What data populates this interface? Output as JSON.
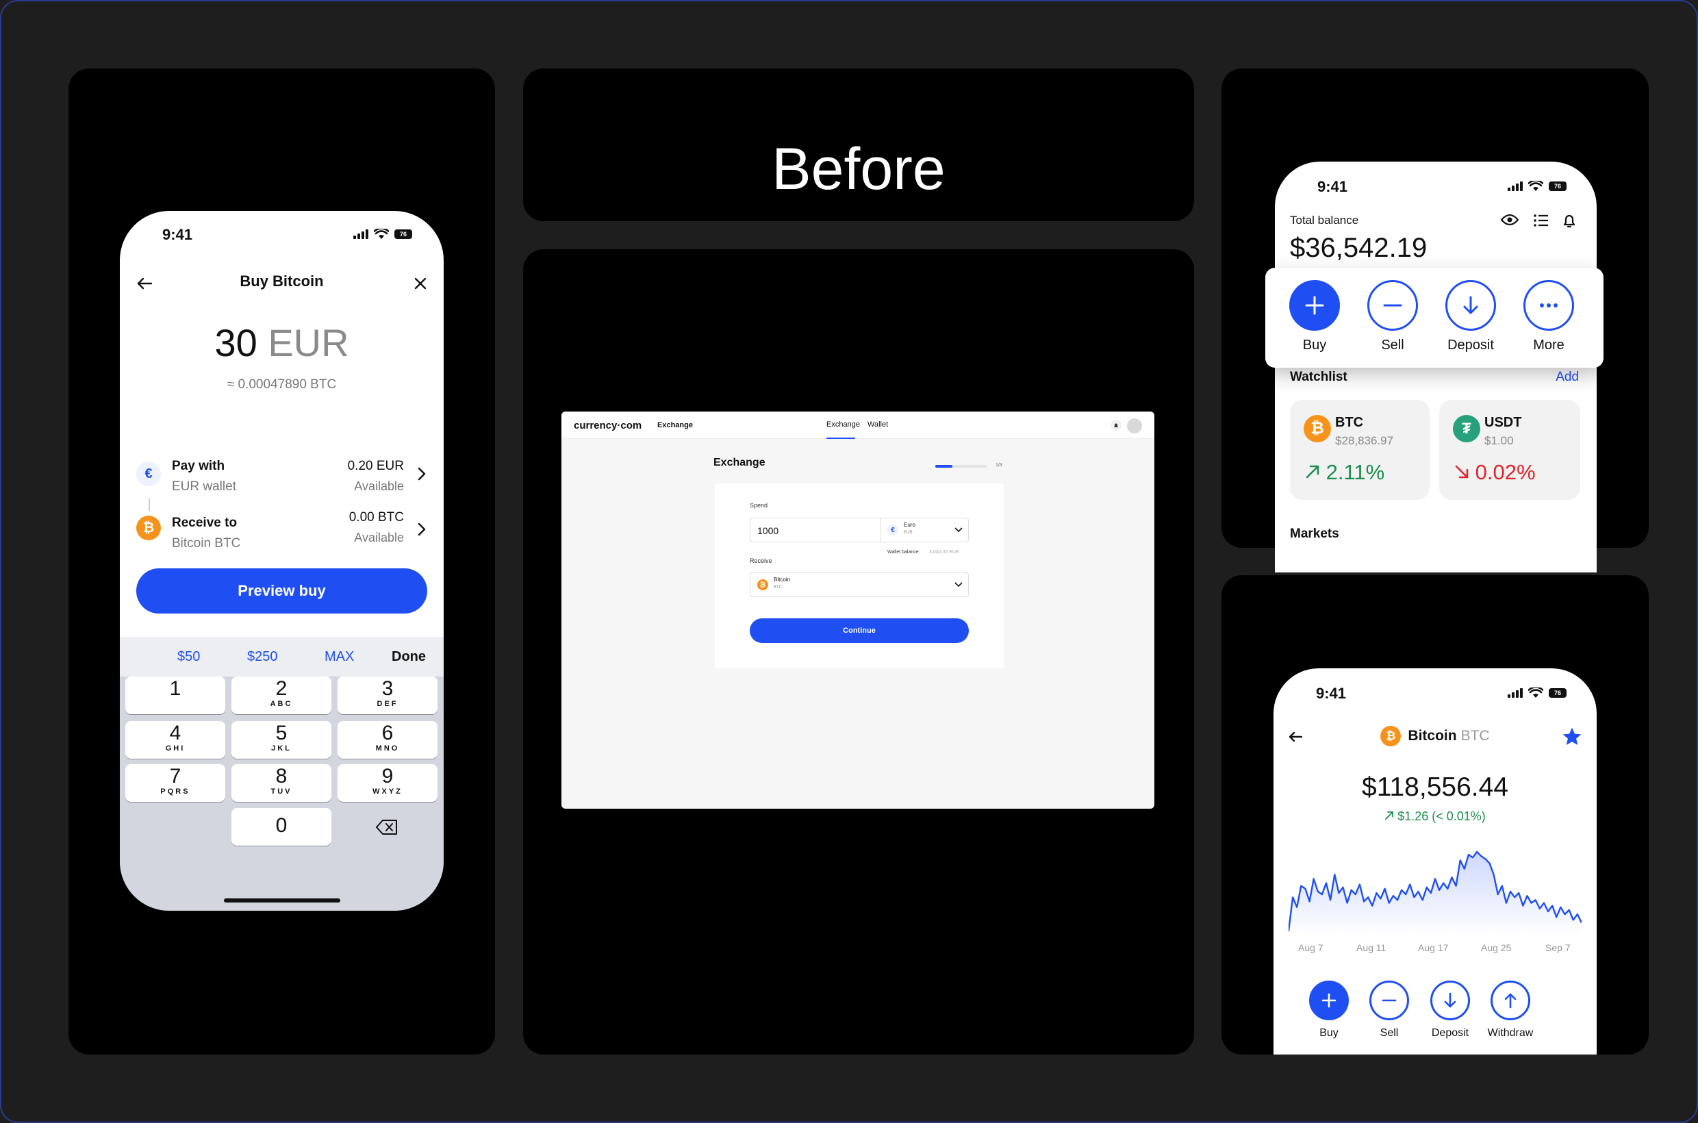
{
  "status_time": "9:41",
  "battery": "76",
  "buy_screen": {
    "title": "Buy Bitcoin",
    "amount_value": "30",
    "amount_currency": "EUR",
    "btc_equivalent": "≈ 0.00047890 BTC",
    "pay_with_label": "Pay with",
    "pay_with_sub": "EUR wallet",
    "pay_with_amount": "0.20 EUR",
    "pay_with_available": "Available",
    "receive_label": "Receive to",
    "receive_sub": "Bitcoin BTC",
    "receive_amount": "0.00 BTC",
    "receive_available": "Available",
    "cta": "Preview buy",
    "quick": [
      "$50",
      "$250",
      "MAX"
    ],
    "done": "Done",
    "keys": [
      {
        "d": "1",
        "l": ""
      },
      {
        "d": "2",
        "l": "ABC"
      },
      {
        "d": "3",
        "l": "DEF"
      },
      {
        "d": "4",
        "l": "GHI"
      },
      {
        "d": "5",
        "l": "JKL"
      },
      {
        "d": "6",
        "l": "MNO"
      },
      {
        "d": "7",
        "l": "PQRS"
      },
      {
        "d": "8",
        "l": "TUV"
      },
      {
        "d": "9",
        "l": "WXYZ"
      },
      {
        "d": "0",
        "l": ""
      }
    ]
  },
  "before_label": "Before",
  "exchange_desktop": {
    "logo": "currency·com",
    "nav_title": "Exchange",
    "tabs": [
      "Exchange",
      "Wallet"
    ],
    "heading": "Exchange",
    "step": "1/3",
    "progress": 0.33,
    "spend_label": "Spend",
    "spend_value": "1000",
    "spend_currency": "Euro",
    "spend_code": "EUR",
    "wallet_balance_label": "Wallet balance:",
    "wallet_balance_value": "3,040.00 EUR",
    "receive_label": "Receive",
    "receive_currency": "Bitcoin",
    "receive_code": "BTC",
    "continue": "Continue"
  },
  "home_screen": {
    "total_label": "Total balance",
    "total_value": "$36,542.19",
    "actions": [
      "Buy",
      "Sell",
      "Deposit",
      "More"
    ],
    "watchlist_label": "Watchlist",
    "add_label": "Add",
    "watchlist": [
      {
        "symbol": "BTC",
        "price": "$28,836.97",
        "change": "2.11%",
        "direction": "up"
      },
      {
        "symbol": "USDT",
        "price": "$1.00",
        "change": "0.02%",
        "direction": "down"
      }
    ],
    "markets_label": "Markets"
  },
  "detail_screen": {
    "coin_name": "Bitcoin",
    "coin_code": "BTC",
    "price": "$118,556.44",
    "change": "$1.26 (< 0.01%)",
    "actions": [
      "Buy",
      "Sell",
      "Deposit",
      "Withdraw"
    ]
  },
  "chart_data": {
    "type": "line",
    "x_labels": [
      "Aug 7",
      "Aug 11",
      "Aug 17",
      "Aug 25",
      "Sep 7"
    ],
    "series": [
      {
        "values": [
          18,
          42,
          35,
          50,
          48,
          39,
          55,
          46,
          44,
          52,
          40,
          58,
          45,
          49,
          38,
          47,
          44,
          51,
          39,
          42,
          36,
          45,
          41,
          48,
          38,
          43,
          40,
          47,
          44,
          51,
          42,
          46,
          40,
          49,
          45,
          55,
          47,
          52,
          48,
          56,
          50,
          68,
          62,
          72,
          70,
          74,
          71,
          69,
          66,
          58,
          44,
          50,
          38,
          46,
          42,
          45,
          36,
          43,
          38,
          40,
          34,
          38,
          32,
          36,
          28,
          35,
          30,
          33,
          26,
          30,
          24
        ]
      }
    ],
    "color": "#1f4ff2"
  },
  "colors": {
    "accent": "#1f4ff2",
    "up": "#1b8f4d",
    "down": "#e0242b",
    "btc": "#f7931a",
    "usdt": "#26a17b"
  }
}
